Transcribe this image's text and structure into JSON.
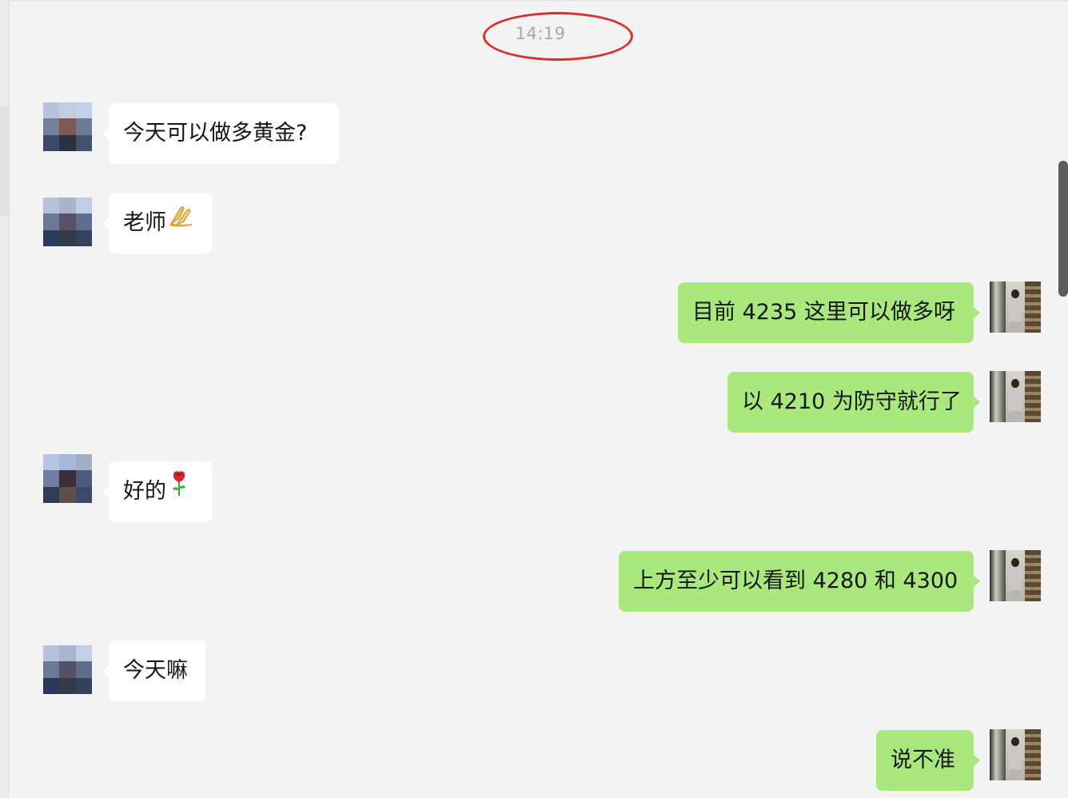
{
  "chat": {
    "timestamp": "14:19",
    "messages": [
      {
        "sender": "contact",
        "text": "今天可以做多黄金?",
        "emoji": ""
      },
      {
        "sender": "contact",
        "text": "老师",
        "emoji": "folded-hands"
      },
      {
        "sender": "self",
        "text": "目前 4235 这里可以做多呀",
        "emoji": ""
      },
      {
        "sender": "self",
        "text": "以 4210 为防守就行了",
        "emoji": ""
      },
      {
        "sender": "contact",
        "text": "好的",
        "emoji": "rose"
      },
      {
        "sender": "self",
        "text": "上方至少可以看到 4280 和 4300",
        "emoji": ""
      },
      {
        "sender": "contact",
        "text": "今天嘛",
        "emoji": ""
      },
      {
        "sender": "self",
        "text": "说不准",
        "emoji": ""
      }
    ]
  },
  "colors": {
    "background": "#f3f3f3",
    "incoming_bubble": "#ffffff",
    "outgoing_bubble": "#a9e87c",
    "highlight_circle": "#d9302a",
    "timestamp_text": "#a8a8a8"
  },
  "icons": {
    "contact_avatar": "pixelated-avatar-icon",
    "self_avatar": "teacher-photo-avatar-icon",
    "emoji_1": "folded-hands-icon",
    "emoji_2": "rose-icon"
  }
}
